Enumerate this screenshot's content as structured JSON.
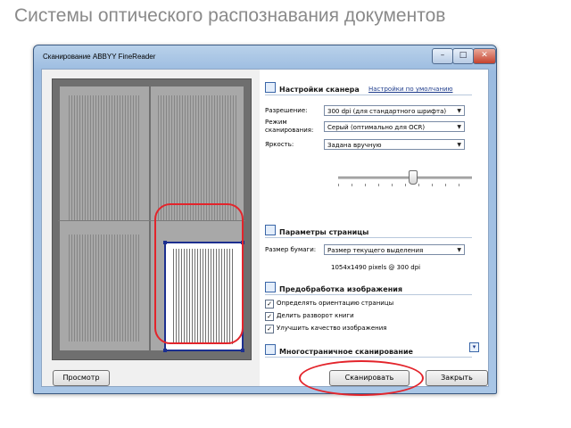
{
  "slide": {
    "title": "Системы оптического распознавания документов"
  },
  "window": {
    "title": "Сканирование ABBYY FineReader",
    "minimize_glyph": "–",
    "maximize_glyph": "□",
    "close_glyph": "✕"
  },
  "scanner_settings": {
    "heading": "Настройки сканера",
    "default_link": "Настройки по умолчанию",
    "resolution_label": "Разрешение:",
    "resolution_value": "300 dpi (для стандартного шрифта)",
    "mode_label": "Режим сканирования:",
    "mode_value": "Серый (оптимально для OCR)",
    "brightness_label": "Яркость:",
    "brightness_value": "Задана вручную",
    "brightness_level": 0.55
  },
  "page_settings": {
    "heading": "Параметры страницы",
    "paper_size_label": "Размер бумаги:",
    "paper_size_value": "Размер текущего выделения",
    "pixels_text": "1054x1490 pixels @ 300 dpi"
  },
  "preprocessing": {
    "heading": "Предобработка изображения",
    "options": [
      {
        "label": "Определять ориентацию страницы",
        "checked": true
      },
      {
        "label": "Делить разворот книги",
        "checked": true
      },
      {
        "label": "Улучшить качество изображения",
        "checked": true
      }
    ]
  },
  "multipage": {
    "heading": "Многостраничное сканирование"
  },
  "buttons": {
    "preview": "Просмотр",
    "scan": "Сканировать",
    "close": "Закрыть"
  },
  "icons": {
    "scanner": "scanner-icon",
    "page": "page-settings-icon",
    "image": "image-preprocessing-icon",
    "multipage": "multipage-icon",
    "expand": "chevron-down-icon"
  },
  "colors": {
    "highlight": "#e3242b",
    "selection_border": "#1c2f8f"
  }
}
